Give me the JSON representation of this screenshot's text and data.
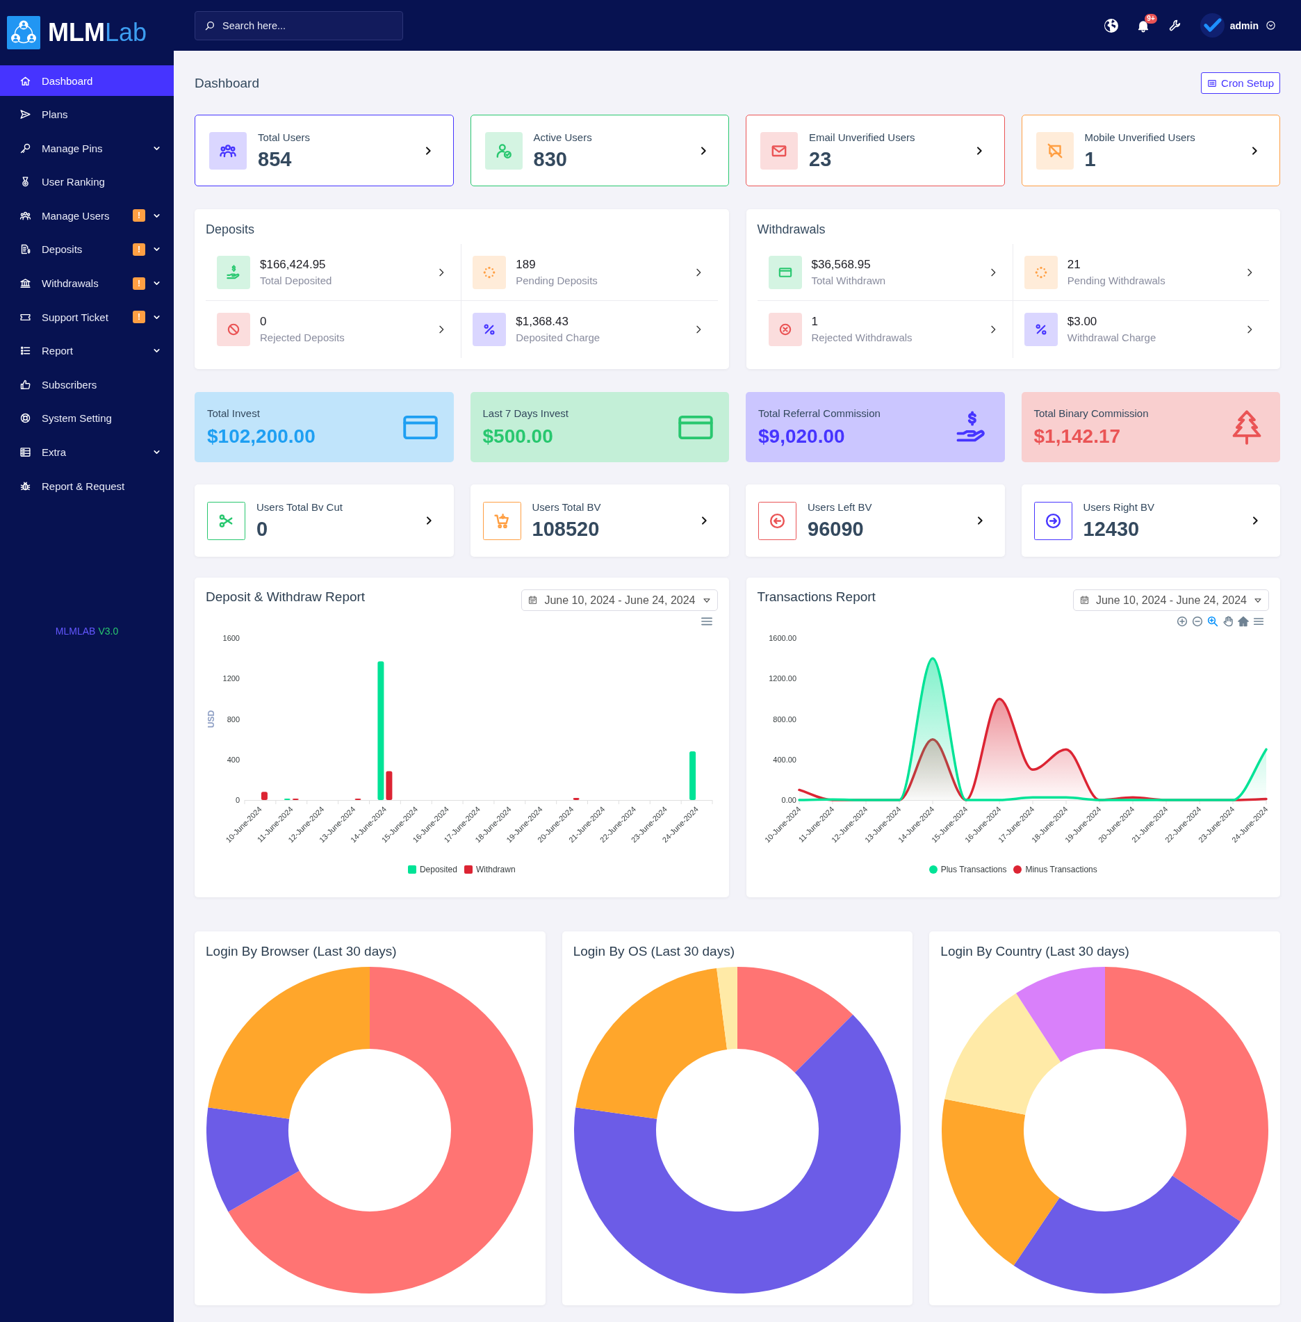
{
  "sidebar": {
    "logo_text": "**MLM**Lab",
    "items": [
      {
        "label": "Dashboard",
        "selected": true,
        "submenu": false
      },
      {
        "label": "Plans",
        "selected": false,
        "submenu": false
      },
      {
        "label": "Manage Pins",
        "selected": false,
        "submenu": true
      },
      {
        "label": "User Ranking",
        "selected": false,
        "submenu": false
      },
      {
        "label": "Manage Users",
        "selected": false,
        "submenu": true,
        "badge": "!"
      },
      {
        "label": "Deposits",
        "selected": false,
        "submenu": true,
        "badge": "!"
      },
      {
        "label": "Withdrawals",
        "selected": false,
        "submenu": true,
        "badge": "!"
      },
      {
        "label": "Support Ticket",
        "selected": false,
        "submenu": true,
        "badge": "!"
      },
      {
        "label": "Report",
        "selected": false,
        "submenu": true
      },
      {
        "label": "Subscribers",
        "selected": false,
        "submenu": false
      },
      {
        "label": "System Setting",
        "selected": false,
        "submenu": false
      },
      {
        "label": "Extra",
        "selected": false,
        "submenu": true
      },
      {
        "label": "Report & Request",
        "selected": false,
        "submenu": false
      }
    ],
    "footer": {
      "brand": "MLMLAB",
      "version": "V3.0"
    }
  },
  "topbar": {
    "search": {
      "placeholder": "Search here..."
    },
    "notification_badge": "9+",
    "user": "admin"
  },
  "page": {
    "title": "Dashboard",
    "cron_button": "Cron Setup"
  },
  "user_stats": [
    {
      "label": "Total Users",
      "value": "854",
      "color": "#4634ff"
    },
    {
      "label": "Active Users",
      "value": "830",
      "color": "#28c76f"
    },
    {
      "label": "Email Unverified Users",
      "value": "23",
      "color": "#ea5455"
    },
    {
      "label": "Mobile Unverified Users",
      "value": "1",
      "color": "#ff9f43"
    }
  ],
  "deposits": {
    "title": "Deposits",
    "items": [
      {
        "value": "$166,424.95",
        "label": "Total Deposited",
        "color": "#28c76f"
      },
      {
        "value": "189",
        "label": "Pending Deposits",
        "color": "#ff9f43"
      },
      {
        "value": "0",
        "label": "Rejected Deposits",
        "color": "#ea5455"
      },
      {
        "value": "$1,368.43",
        "label": "Deposited Charge",
        "color": "#4634ff"
      }
    ]
  },
  "withdrawals": {
    "title": "Withdrawals",
    "items": [
      {
        "value": "$36,568.95",
        "label": "Total Withdrawn",
        "color": "#28c76f"
      },
      {
        "value": "21",
        "label": "Pending Withdrawals",
        "color": "#ff9f43"
      },
      {
        "value": "1",
        "label": "Rejected Withdrawals",
        "color": "#ea5455"
      },
      {
        "value": "$3.00",
        "label": "Withdrawal Charge",
        "color": "#4634ff"
      }
    ]
  },
  "invest_stats": [
    {
      "label": "Total Invest",
      "value": "$102,200.00",
      "color": "#1e9ff2"
    },
    {
      "label": "Last 7 Days Invest",
      "value": "$500.00",
      "color": "#28c76f"
    },
    {
      "label": "Total Referral Commission",
      "value": "$9,020.00",
      "color": "#4634ff"
    },
    {
      "label": "Total Binary Commission",
      "value": "$1,142.17",
      "color": "#ea5455"
    }
  ],
  "bv_stats": [
    {
      "label": "Users Total Bv Cut",
      "value": "0",
      "color": "#28c76f"
    },
    {
      "label": "Users Total BV",
      "value": "108520",
      "color": "#ff9f43"
    },
    {
      "label": "Users Left BV",
      "value": "96090",
      "color": "#ea5455"
    },
    {
      "label": "Users Right BV",
      "value": "12430",
      "color": "#4634ff"
    }
  ],
  "reports": [
    {
      "title": "Deposit & Withdraw Report",
      "date_range": "June 10, 2024 - June 24, 2024",
      "chart_data": {
        "type": "bar",
        "ylabel": "USD",
        "categories": [
          "10-June-2024",
          "11-June-2024",
          "12-June-2024",
          "13-June-2024",
          "14-June-2024",
          "15-June-2024",
          "16-June-2024",
          "17-June-2024",
          "18-June-2024",
          "19-June-2024",
          "20-June-2024",
          "21-June-2024",
          "22-June-2024",
          "23-June-2024",
          "24-June-2024"
        ],
        "series": [
          {
            "name": "Deposited",
            "color": "#00e396",
            "values": [
              0,
              5,
              0,
              0,
              1370,
              0,
              0,
              0,
              0,
              0,
              0,
              0,
              0,
              0,
              480
            ]
          },
          {
            "name": "Withdrawn",
            "color": "#dc2433",
            "values": [
              80,
              5,
              0,
              2,
              285,
              0,
              0,
              0,
              0,
              0,
              20,
              0,
              0,
              0,
              0
            ]
          }
        ],
        "ylim": [
          0,
          1600
        ],
        "yticks": [
          0,
          400,
          800,
          1200,
          1600
        ],
        "legend": "bottom"
      }
    },
    {
      "title": "Transactions Report",
      "date_range": "June 10, 2024 - June 24, 2024",
      "chart_data": {
        "type": "area",
        "categories": [
          "10-June-2024",
          "11-June-2024",
          "12-June-2024",
          "13-June-2024",
          "14-June-2024",
          "15-June-2024",
          "16-June-2024",
          "17-June-2024",
          "18-June-2024",
          "19-June-2024",
          "20-June-2024",
          "21-June-2024",
          "22-June-2024",
          "23-June-2024",
          "24-June-2024"
        ],
        "series": [
          {
            "name": "Plus Transactions",
            "color": "#00e396",
            "values": [
              0,
              5,
              0,
              0,
              1400,
              0,
              0,
              25,
              25,
              0,
              0,
              0,
              0,
              0,
              500
            ]
          },
          {
            "name": "Minus Transactions",
            "color": "#dc2433",
            "values": [
              100,
              0,
              0,
              0,
              600,
              0,
              1000,
              300,
              500,
              0,
              25,
              0,
              0,
              0,
              10
            ]
          }
        ],
        "ylim": [
          0,
          1600
        ],
        "yticks": [
          {
            "value": 0,
            "label": "0.00"
          },
          {
            "value": 400,
            "label": "400.00"
          },
          {
            "value": 800,
            "label": "800.00"
          },
          {
            "value": 1200,
            "label": "1200.00"
          },
          {
            "value": 1600,
            "label": "1600.00"
          }
        ],
        "legend": "bottom"
      }
    }
  ],
  "login_charts": [
    {
      "title": "Login By Browser (Last 30 days)"
    },
    {
      "title": "Login By OS (Last 30 days)"
    },
    {
      "title": "Login By Country (Last 30 days)"
    }
  ]
}
